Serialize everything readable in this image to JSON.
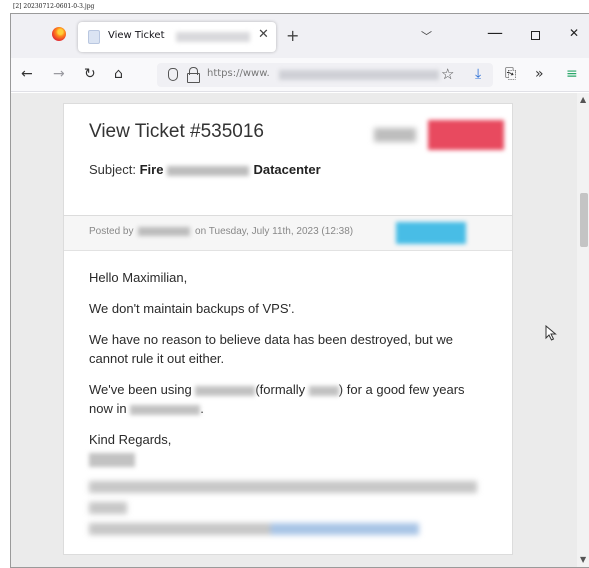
{
  "caption": "[2] 20230712-0601-0-3.jpg",
  "browser": {
    "tab_title": "View Ticket",
    "url_prefix": "https://www."
  },
  "ticket": {
    "title": "View Ticket #535016",
    "subject_label": "Subject:",
    "subject_start": "Fire",
    "subject_end": "Datacenter",
    "posted_by": "Posted by",
    "posted_on": "on Tuesday, July 11th, 2023 (12:38)",
    "message": {
      "greeting": "Hello Maximilian,",
      "line1": "We don't maintain backups of VPS'.",
      "line2": "We have no reason to believe data has been destroyed, but we cannot rule it out either.",
      "line3_a": "We've been using",
      "line3_b": "(formally",
      "line3_c": ") for a good few",
      "line3_d": "years now in",
      "line3_e": ".",
      "closing": "Kind Regards,"
    }
  },
  "colors": {
    "status_badge": "#e84a5f",
    "meta_badge": "#48bde6",
    "page_bg": "#ebebeb"
  }
}
